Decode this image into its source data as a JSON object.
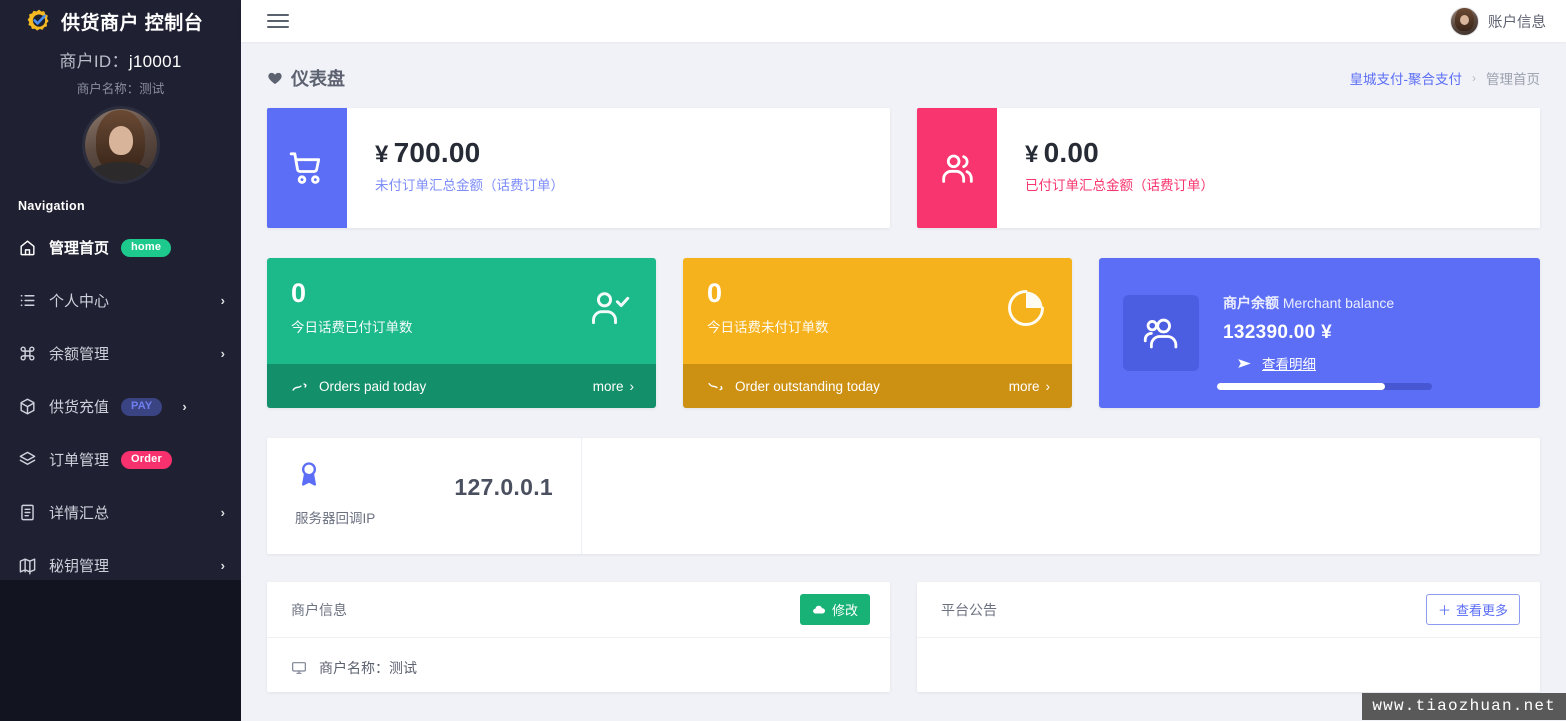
{
  "sidebar": {
    "brand_title": "供货商户 控制台",
    "brand_logo_icon": "gear-check-icon",
    "merchant_id_label": "商户ID：",
    "merchant_id_value": "j10001",
    "merchant_name": "商户名称：测试",
    "nav_heading": "Navigation",
    "items": [
      {
        "label": "管理首页",
        "icon": "home-icon",
        "badge": "home",
        "badge_color": "#1dc98c",
        "chevron": false,
        "active": true
      },
      {
        "label": "个人中心",
        "icon": "list-icon",
        "badge": "",
        "badge_color": "",
        "chevron": true,
        "active": false
      },
      {
        "label": "余额管理",
        "icon": "command-icon",
        "badge": "",
        "badge_color": "",
        "chevron": true,
        "active": false
      },
      {
        "label": "供货充值",
        "icon": "box-icon",
        "badge": "PAY",
        "badge_color": "#6f7ff0",
        "chevron": true,
        "active": false
      },
      {
        "label": "订单管理",
        "icon": "layers-icon",
        "badge": "Order",
        "badge_color": "#f7316d",
        "chevron": false,
        "active": false
      },
      {
        "label": "详情汇总",
        "icon": "file-icon",
        "badge": "",
        "badge_color": "",
        "chevron": true,
        "active": false
      },
      {
        "label": "秘钥管理",
        "icon": "map-icon",
        "badge": "",
        "badge_color": "",
        "chevron": true,
        "active": false
      }
    ]
  },
  "topbar": {
    "menu_icon": "hamburger-icon",
    "avatar_icon": "user-avatar",
    "account_label": "账户信息"
  },
  "page": {
    "heart_icon": "heart-icon",
    "title": "仪表盘",
    "breadcrumb_link": "皇城支付-聚合支付",
    "breadcrumb_sep": "›",
    "breadcrumb_current": "管理首页"
  },
  "stats_wide": [
    {
      "icon": "shopping-cart-icon",
      "accent": "#5b6ef5",
      "currency": "¥",
      "amount": "700.00",
      "caption": "未付订单汇总金额（话费订单）"
    },
    {
      "icon": "users-icon",
      "accent": "#f8356e",
      "currency": "¥",
      "amount": "0.00",
      "caption": "已付订单汇总金额（话费订单）"
    }
  ],
  "stats_mini": [
    {
      "number": "0",
      "caption": "今日话费已付订单数",
      "icon": "user-check-icon",
      "trend_icon": "trend-up-icon",
      "footer_label": "Orders paid today",
      "more_label": "more",
      "color": "#1cb98a",
      "footer_color": "#138f6a"
    },
    {
      "number": "0",
      "caption": "今日话费未付订单数",
      "icon": "pie-chart-icon",
      "trend_icon": "trend-down-icon",
      "footer_label": "Order outstanding today",
      "more_label": "more",
      "color": "#f5b21c",
      "footer_color": "#cc9013"
    }
  ],
  "balance": {
    "icon": "users-group-icon",
    "title_cn": "商户余额",
    "title_en": " Merchant balance",
    "amount": "132390.00 ¥",
    "link_icon": "send-icon",
    "link_label": "查看明细",
    "progress_percent": 78,
    "bg_color": "#5b6ef5"
  },
  "server": {
    "icon": "award-icon",
    "label": "服务器回调IP",
    "value": "127.0.0.1"
  },
  "panels": {
    "merchant_info": {
      "title": "商户信息",
      "button_label": "修改",
      "button_icon": "cloud-icon",
      "row_icon": "monitor-icon",
      "row_text": "商户名称：测试"
    },
    "announcement": {
      "title": "平台公告",
      "button_label": "查看更多",
      "button_icon": "plus-icon"
    }
  },
  "watermark": "www.tiaozhuan.net"
}
